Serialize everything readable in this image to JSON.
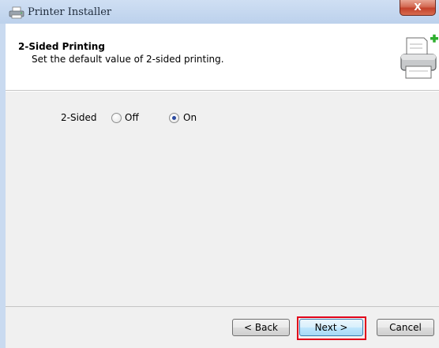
{
  "window": {
    "title": "Printer Installer",
    "close_label": "X",
    "app_icon": "printer-icon",
    "title_color": "#bcd1ec",
    "close_color": "#c3412a"
  },
  "header": {
    "title": "2-Sided Printing",
    "subtitle": "Set the default value of 2-sided printing.",
    "icon": "printer-add-icon"
  },
  "option": {
    "label": "2-Sided",
    "choices": [
      {
        "label": "Off",
        "selected": false
      },
      {
        "label": "On",
        "selected": true
      }
    ]
  },
  "buttons": {
    "back": "< Back",
    "next": "Next >",
    "cancel": "Cancel"
  },
  "highlight_color": "#e0001a"
}
